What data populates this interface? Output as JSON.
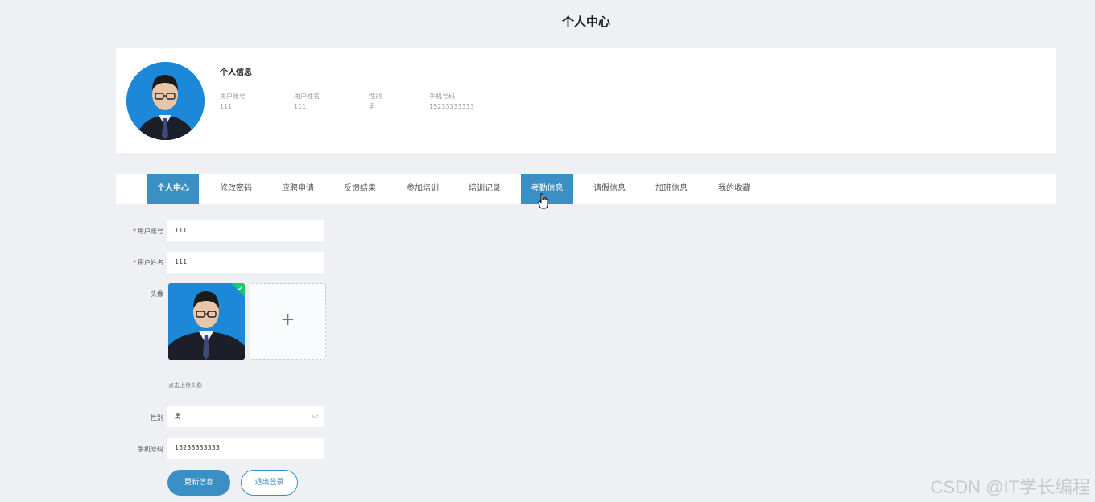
{
  "header": {
    "title": "个人中心"
  },
  "profile": {
    "section_title": "个人信息",
    "fields": [
      {
        "label": "用户账号",
        "value": "111"
      },
      {
        "label": "用户姓名",
        "value": "111"
      },
      {
        "label": "性别",
        "value": "男"
      },
      {
        "label": "手机号码",
        "value": "15233333333"
      }
    ]
  },
  "tabs": [
    {
      "label": "个人中心",
      "state": "active"
    },
    {
      "label": "修改密码"
    },
    {
      "label": "应聘申请"
    },
    {
      "label": "反馈结果"
    },
    {
      "label": "参加培训"
    },
    {
      "label": "培训记录"
    },
    {
      "label": "考勤信息",
      "state": "hover"
    },
    {
      "label": "请假信息"
    },
    {
      "label": "加班信息"
    },
    {
      "label": "我的收藏"
    }
  ],
  "form": {
    "account": {
      "label": "用户账号",
      "value": "111",
      "required": true
    },
    "name": {
      "label": "用户姓名",
      "value": "111",
      "required": true
    },
    "avatar": {
      "label": "头像",
      "tip": "点击上传头像",
      "add_symbol": "+"
    },
    "gender": {
      "label": "性别",
      "value": "男"
    },
    "phone": {
      "label": "手机号码",
      "value": "15233333333"
    },
    "required_mark": "*"
  },
  "buttons": {
    "update": "更新信息",
    "logout": "退出登录"
  },
  "watermark": "CSDN @IT学长编程",
  "colors": {
    "accent": "#3a8fc5",
    "background": "#eef0f3",
    "avatar_bg": "#1e88d8",
    "success": "#13ce66"
  }
}
